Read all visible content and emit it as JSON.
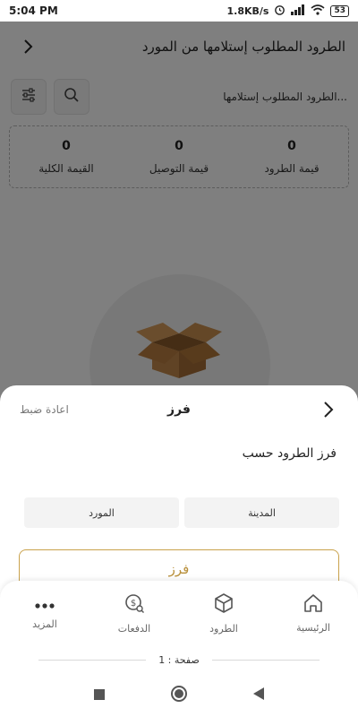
{
  "status_bar": {
    "time": "5:04 PM",
    "speed": "1.8KB/s",
    "battery": "53"
  },
  "header": {
    "title": "الطرود المطلوب إستلامها من المورد"
  },
  "search": {
    "placeholder": "الطرود المطلوب إستلامها..."
  },
  "summary": {
    "items": [
      {
        "label": "قيمة الطرود",
        "value": "0"
      },
      {
        "label": "قيمة التوصيل",
        "value": "0"
      },
      {
        "label": "القيمة الكلية",
        "value": "0"
      }
    ]
  },
  "sheet": {
    "title": "فرز",
    "reset_label": "اعادة ضبط",
    "sort_by_label": "فرز الطرود حسب",
    "options": [
      "المدينة",
      "المورد"
    ],
    "sort_button": "فرز"
  },
  "bottom_nav": {
    "items": [
      {
        "label": "الرئيسية",
        "icon": "home-icon"
      },
      {
        "label": "الطرود",
        "icon": "box-icon"
      },
      {
        "label": "الدفعات",
        "icon": "payments-icon"
      },
      {
        "label": "المزيد",
        "icon": "more-icon"
      }
    ]
  },
  "pager": {
    "text": "صفحة : 1"
  },
  "colors": {
    "accent": "#c9a24c",
    "accent_text": "#b88f3a",
    "overlay": "rgba(0,0,0,0.5)"
  }
}
